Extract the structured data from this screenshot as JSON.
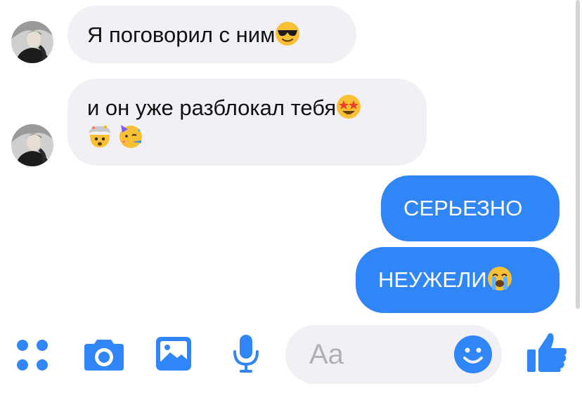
{
  "conversation": {
    "messages": [
      {
        "direction": "incoming",
        "text": "Я поговорил с ним",
        "emojis": [
          "smiling-face-with-sunglasses"
        ]
      },
      {
        "direction": "incoming",
        "text": "и он уже разблокал тебя",
        "emojis": [
          "star-struck",
          "exploding-head",
          "partying-face"
        ]
      },
      {
        "direction": "outgoing",
        "text": "СЕРЬЕЗНО",
        "emojis": []
      },
      {
        "direction": "outgoing",
        "text": "НЕУЖЕЛИ",
        "emojis": [
          "loudly-crying-face"
        ]
      }
    ]
  },
  "composer": {
    "placeholder": "Aa",
    "icons": [
      "more-dots-icon",
      "camera-icon",
      "gallery-icon",
      "microphone-icon",
      "emoji-icon",
      "thumbs-up-icon"
    ]
  },
  "colors": {
    "outgoing_bubble": "#3086f7",
    "incoming_bubble": "#f1f0f5",
    "accent": "#3086f7"
  }
}
